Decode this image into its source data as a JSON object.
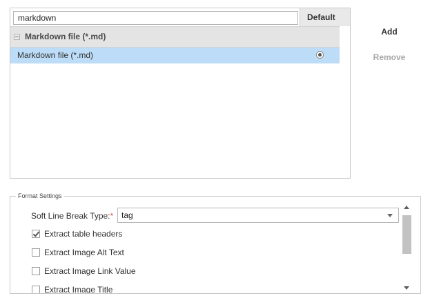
{
  "search": {
    "value": "markdown"
  },
  "list": {
    "default_header": "Default",
    "group_label": "Markdown file (*.md)",
    "item_label": "Markdown file (*.md)",
    "item_is_default": true
  },
  "actions": {
    "add_label": "Add",
    "remove_label": "Remove"
  },
  "format_settings": {
    "legend": "Format Settings",
    "soft_line_break": {
      "label": "Soft Line Break Type:",
      "required_mark": "*",
      "value": "tag"
    },
    "options": [
      {
        "label": "Extract table headers",
        "checked": true
      },
      {
        "label": "Extract Image Alt Text",
        "checked": false
      },
      {
        "label": "Extract Image Link Value",
        "checked": false
      },
      {
        "label": "Extract Image Title",
        "checked": false
      }
    ]
  },
  "colors": {
    "selected_row": "#bcdcf7",
    "group_row": "#e4e4e4",
    "required": "#d9534f",
    "disabled_text": "#a8a8a8"
  }
}
